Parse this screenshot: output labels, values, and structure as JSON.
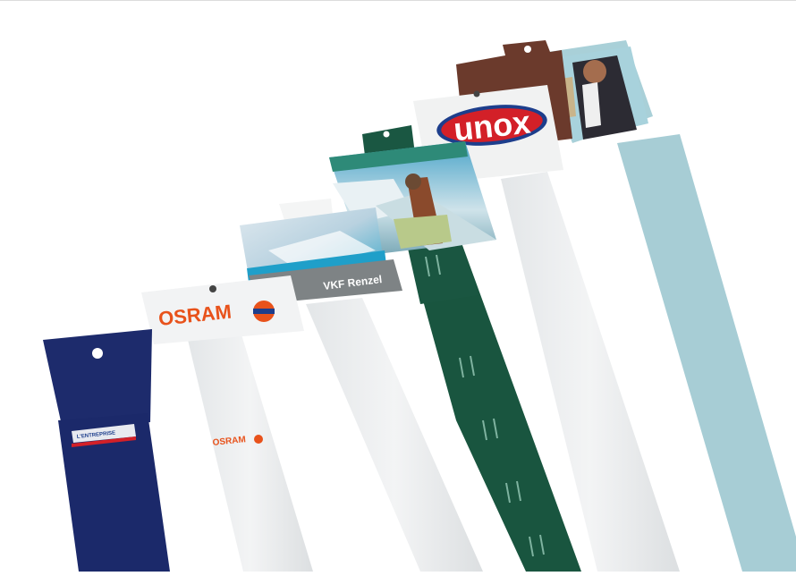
{
  "brands": {
    "osram": "OSRAM",
    "osram_small": "OSRAM",
    "vkf": "VKF Renzel",
    "unox": "unox",
    "navy_badge": "L'ENTREPRISE"
  },
  "colors": {
    "navy": "#1c2a6b",
    "green": "#18553f",
    "white_strip": "#eef0f1",
    "light_blue": "#9ec6cf",
    "brown": "#6a3b2e",
    "osram_orange": "#e8521b",
    "unox_red": "#d32028",
    "unox_blue": "#1d3e8c",
    "vkf_grey": "#7e8385"
  }
}
